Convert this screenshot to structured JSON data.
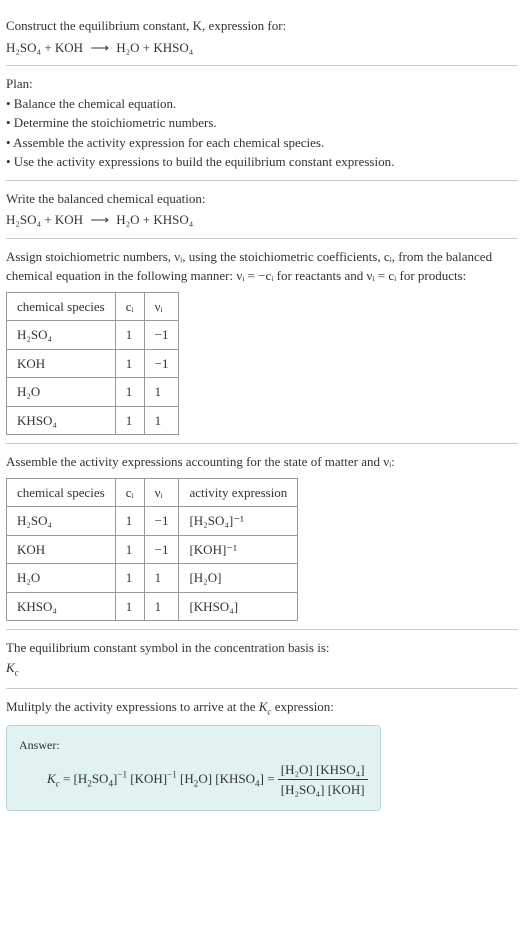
{
  "intro": {
    "line1": "Construct the equilibrium constant, K, expression for:",
    "equation_left": "H₂SO₄ + KOH",
    "equation_arrow": "⟶",
    "equation_right": "H₂O + KHSO₄"
  },
  "plan": {
    "heading": "Plan:",
    "b1": "• Balance the chemical equation.",
    "b2": "• Determine the stoichiometric numbers.",
    "b3": "• Assemble the activity expression for each chemical species.",
    "b4": "• Use the activity expressions to build the equilibrium constant expression."
  },
  "balanced": {
    "heading": "Write the balanced chemical equation:",
    "equation_left": "H₂SO₄ + KOH",
    "equation_arrow": "⟶",
    "equation_right": "H₂O + KHSO₄"
  },
  "stoich": {
    "intro_a": "Assign stoichiometric numbers, νᵢ, using the stoichiometric coefficients, cᵢ, from the balanced chemical equation in the following manner: νᵢ = −cᵢ for reactants and νᵢ = cᵢ for products:",
    "headers": {
      "species": "chemical species",
      "ci": "cᵢ",
      "vi": "νᵢ"
    },
    "rows": [
      {
        "species": "H₂SO₄",
        "ci": "1",
        "vi": "−1"
      },
      {
        "species": "KOH",
        "ci": "1",
        "vi": "−1"
      },
      {
        "species": "H₂O",
        "ci": "1",
        "vi": "1"
      },
      {
        "species": "KHSO₄",
        "ci": "1",
        "vi": "1"
      }
    ]
  },
  "activity": {
    "intro": "Assemble the activity expressions accounting for the state of matter and νᵢ:",
    "headers": {
      "species": "chemical species",
      "ci": "cᵢ",
      "vi": "νᵢ",
      "expr": "activity expression"
    },
    "rows": [
      {
        "species": "H₂SO₄",
        "ci": "1",
        "vi": "−1",
        "expr": "[H₂SO₄]⁻¹"
      },
      {
        "species": "KOH",
        "ci": "1",
        "vi": "−1",
        "expr": "[KOH]⁻¹"
      },
      {
        "species": "H₂O",
        "ci": "1",
        "vi": "1",
        "expr": "[H₂O]"
      },
      {
        "species": "KHSO₄",
        "ci": "1",
        "vi": "1",
        "expr": "[KHSO₄]"
      }
    ]
  },
  "symbol": {
    "line1": "The equilibrium constant symbol in the concentration basis is:",
    "kc": "K_c"
  },
  "multiply": {
    "line1": "Mulitply the activity expressions to arrive at the K_c expression:"
  },
  "answer": {
    "label": "Answer:",
    "lhs": "K_c = [H₂SO₄]⁻¹ [KOH]⁻¹ [H₂O] [KHSO₄] =",
    "num": "[H₂O] [KHSO₄]",
    "den": "[H₂SO₄] [KOH]"
  },
  "chart_data": {
    "type": "table",
    "tables": [
      {
        "title": "Stoichiometric numbers",
        "columns": [
          "chemical species",
          "cᵢ",
          "νᵢ"
        ],
        "rows": [
          [
            "H₂SO₄",
            1,
            -1
          ],
          [
            "KOH",
            1,
            -1
          ],
          [
            "H₂O",
            1,
            1
          ],
          [
            "KHSO₄",
            1,
            1
          ]
        ]
      },
      {
        "title": "Activity expressions",
        "columns": [
          "chemical species",
          "cᵢ",
          "νᵢ",
          "activity expression"
        ],
        "rows": [
          [
            "H₂SO₄",
            1,
            -1,
            "[H₂SO₄]⁻¹"
          ],
          [
            "KOH",
            1,
            -1,
            "[KOH]⁻¹"
          ],
          [
            "H₂O",
            1,
            1,
            "[H₂O]"
          ],
          [
            "KHSO₄",
            1,
            1,
            "[KHSO₄]"
          ]
        ]
      }
    ]
  }
}
